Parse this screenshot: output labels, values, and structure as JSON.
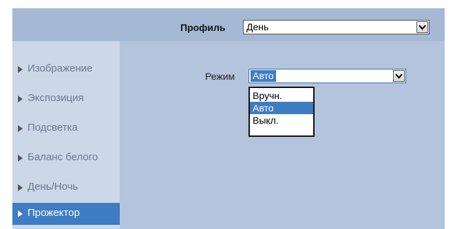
{
  "header": {
    "profile_label": "Профиль",
    "profile_value": "День"
  },
  "sidebar": {
    "items": [
      {
        "label": "Изображение",
        "active": false
      },
      {
        "label": "Экспозиция",
        "active": false
      },
      {
        "label": "Подсветка",
        "active": false
      },
      {
        "label": "Баланс белого",
        "active": false
      },
      {
        "label": "День/Ночь",
        "active": false
      },
      {
        "label": "Прожектор",
        "active": true
      }
    ]
  },
  "main": {
    "mode_label": "Режим",
    "mode_value": "Авто",
    "mode_options": [
      {
        "label": "Вручн.",
        "selected": false
      },
      {
        "label": "Авто",
        "selected": true
      },
      {
        "label": "Выкл.",
        "selected": false
      }
    ]
  },
  "colors": {
    "accent": "#3e7cc4",
    "panel_bg": "#b3c4dc",
    "topbar_bg": "#a5b9d5",
    "sidebar_bg": "#ccd7e8"
  },
  "icons": {
    "select_arrow": "chevron-down-icon",
    "nav_bullet": "triangle-right-icon"
  }
}
